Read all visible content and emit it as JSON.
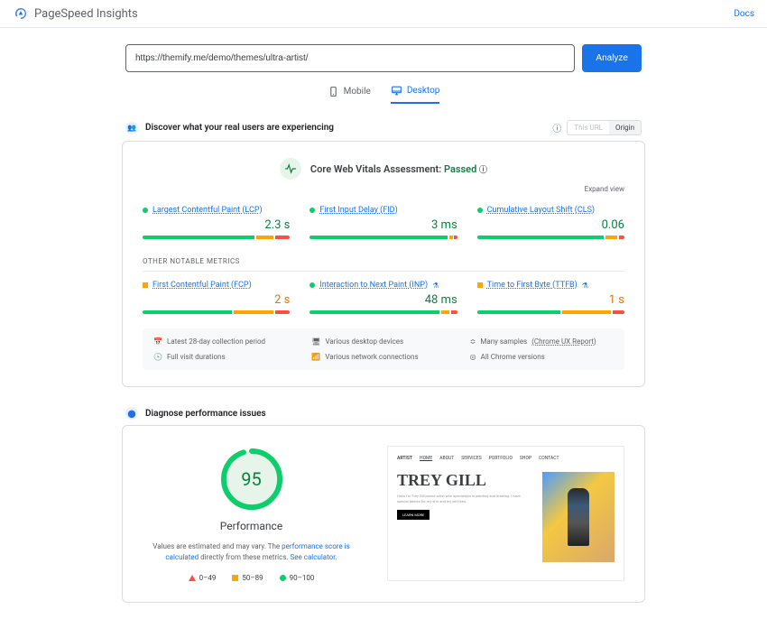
{
  "header": {
    "title": "PageSpeed Insights",
    "docs": "Docs"
  },
  "search": {
    "url": "https://themify.me/demo/themes/ultra-artist/",
    "analyze": "Analyze"
  },
  "tabs": {
    "mobile": "Mobile",
    "desktop": "Desktop"
  },
  "discover": {
    "title": "Discover what your real users are experiencing",
    "thisUrl": "This URL",
    "origin": "Origin"
  },
  "vitals": {
    "title": "Core Web Vitals Assessment:",
    "status": "Passed",
    "expand": "Expand view"
  },
  "metrics": [
    {
      "name": "Largest Contentful Paint (LCP)",
      "value": "2.3 s",
      "status": "green",
      "bars": [
        78,
        12,
        10
      ],
      "marker": 70
    },
    {
      "name": "First Input Delay (FID)",
      "value": "3 ms",
      "status": "green",
      "bars": [
        96,
        2,
        2
      ],
      "marker": 50
    },
    {
      "name": "Cumulative Layout Shift (CLS)",
      "value": "0.06",
      "status": "green",
      "bars": [
        88,
        8,
        4
      ],
      "marker": 68
    }
  ],
  "otherLabel": "OTHER NOTABLE METRICS",
  "otherMetrics": [
    {
      "name": "First Contentful Paint (FCP)",
      "value": "2 s",
      "status": "orange",
      "bars": [
        62,
        28,
        10
      ],
      "marker": 68,
      "badge": false
    },
    {
      "name": "Interaction to Next Paint (INP)",
      "value": "48 ms",
      "status": "green",
      "bars": [
        90,
        6,
        4
      ],
      "marker": 50,
      "badge": true
    },
    {
      "name": "Time to First Byte (TTFB)",
      "value": "1 s",
      "status": "orange",
      "bars": [
        58,
        34,
        8
      ],
      "marker": 72,
      "badge": true
    }
  ],
  "footer": {
    "period": "Latest 28-day collection period",
    "devices": "Various desktop devices",
    "samples": "Many samples",
    "samplesLink": "(Chrome UX Report)",
    "durations": "Full visit durations",
    "network": "Various network connections",
    "versions": "All Chrome versions"
  },
  "diagnose": {
    "title": "Diagnose performance issues",
    "score": "95",
    "label": "Performance",
    "text1": "Values are estimated and may vary. The ",
    "link1": "performance score is calculated",
    "text2": " directly from these metrics. ",
    "link2": "See calculator.",
    "legend": {
      "low": "0–49",
      "mid": "50–89",
      "high": "90–100"
    }
  },
  "preview": {
    "nav": [
      "ARTIST",
      "HOME",
      "ABOUT",
      "SERVICES",
      "PORTFOLIO",
      "SHOP",
      "CONTACT"
    ],
    "name": "TREY GILL",
    "cta": "LEARN MORE"
  }
}
